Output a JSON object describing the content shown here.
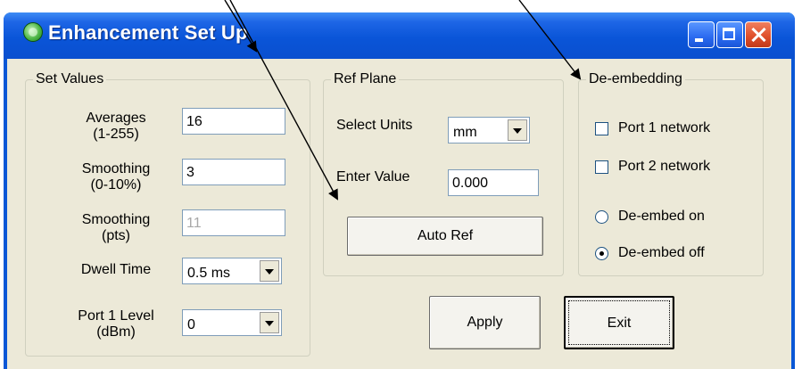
{
  "window": {
    "title": "Enhancement Set Up"
  },
  "set_values": {
    "legend": "Set Values",
    "averages_label": "Averages\n(1-255)",
    "averages_value": "16",
    "smoothing_pct_label": "Smoothing\n(0-10%)",
    "smoothing_pct_value": "3",
    "smoothing_pts_label": "Smoothing\n(pts)",
    "smoothing_pts_value": "11",
    "dwell_label": "Dwell Time",
    "dwell_value": "0.5 ms",
    "port1_level_label": "Port 1 Level\n(dBm)",
    "port1_level_value": "0"
  },
  "ref_plane": {
    "legend": "Ref Plane",
    "units_label": "Select Units",
    "units_value": "mm",
    "enter_label": "Enter Value",
    "enter_value": "0.000",
    "auto_ref_label": "Auto Ref"
  },
  "deembedding": {
    "legend": "De-embedding",
    "port1_label": "Port 1 network",
    "port1_checked": false,
    "port2_label": "Port 2 network",
    "port2_checked": false,
    "on_label": "De-embed on",
    "off_label": "De-embed off",
    "selected": "De-embed off"
  },
  "buttons": {
    "apply_label": "Apply",
    "exit_label": "Exit"
  },
  "colors": {
    "titlebar": "#0a55d8",
    "dialog_bg": "#ece9d8",
    "close_button": "#e0502c"
  }
}
